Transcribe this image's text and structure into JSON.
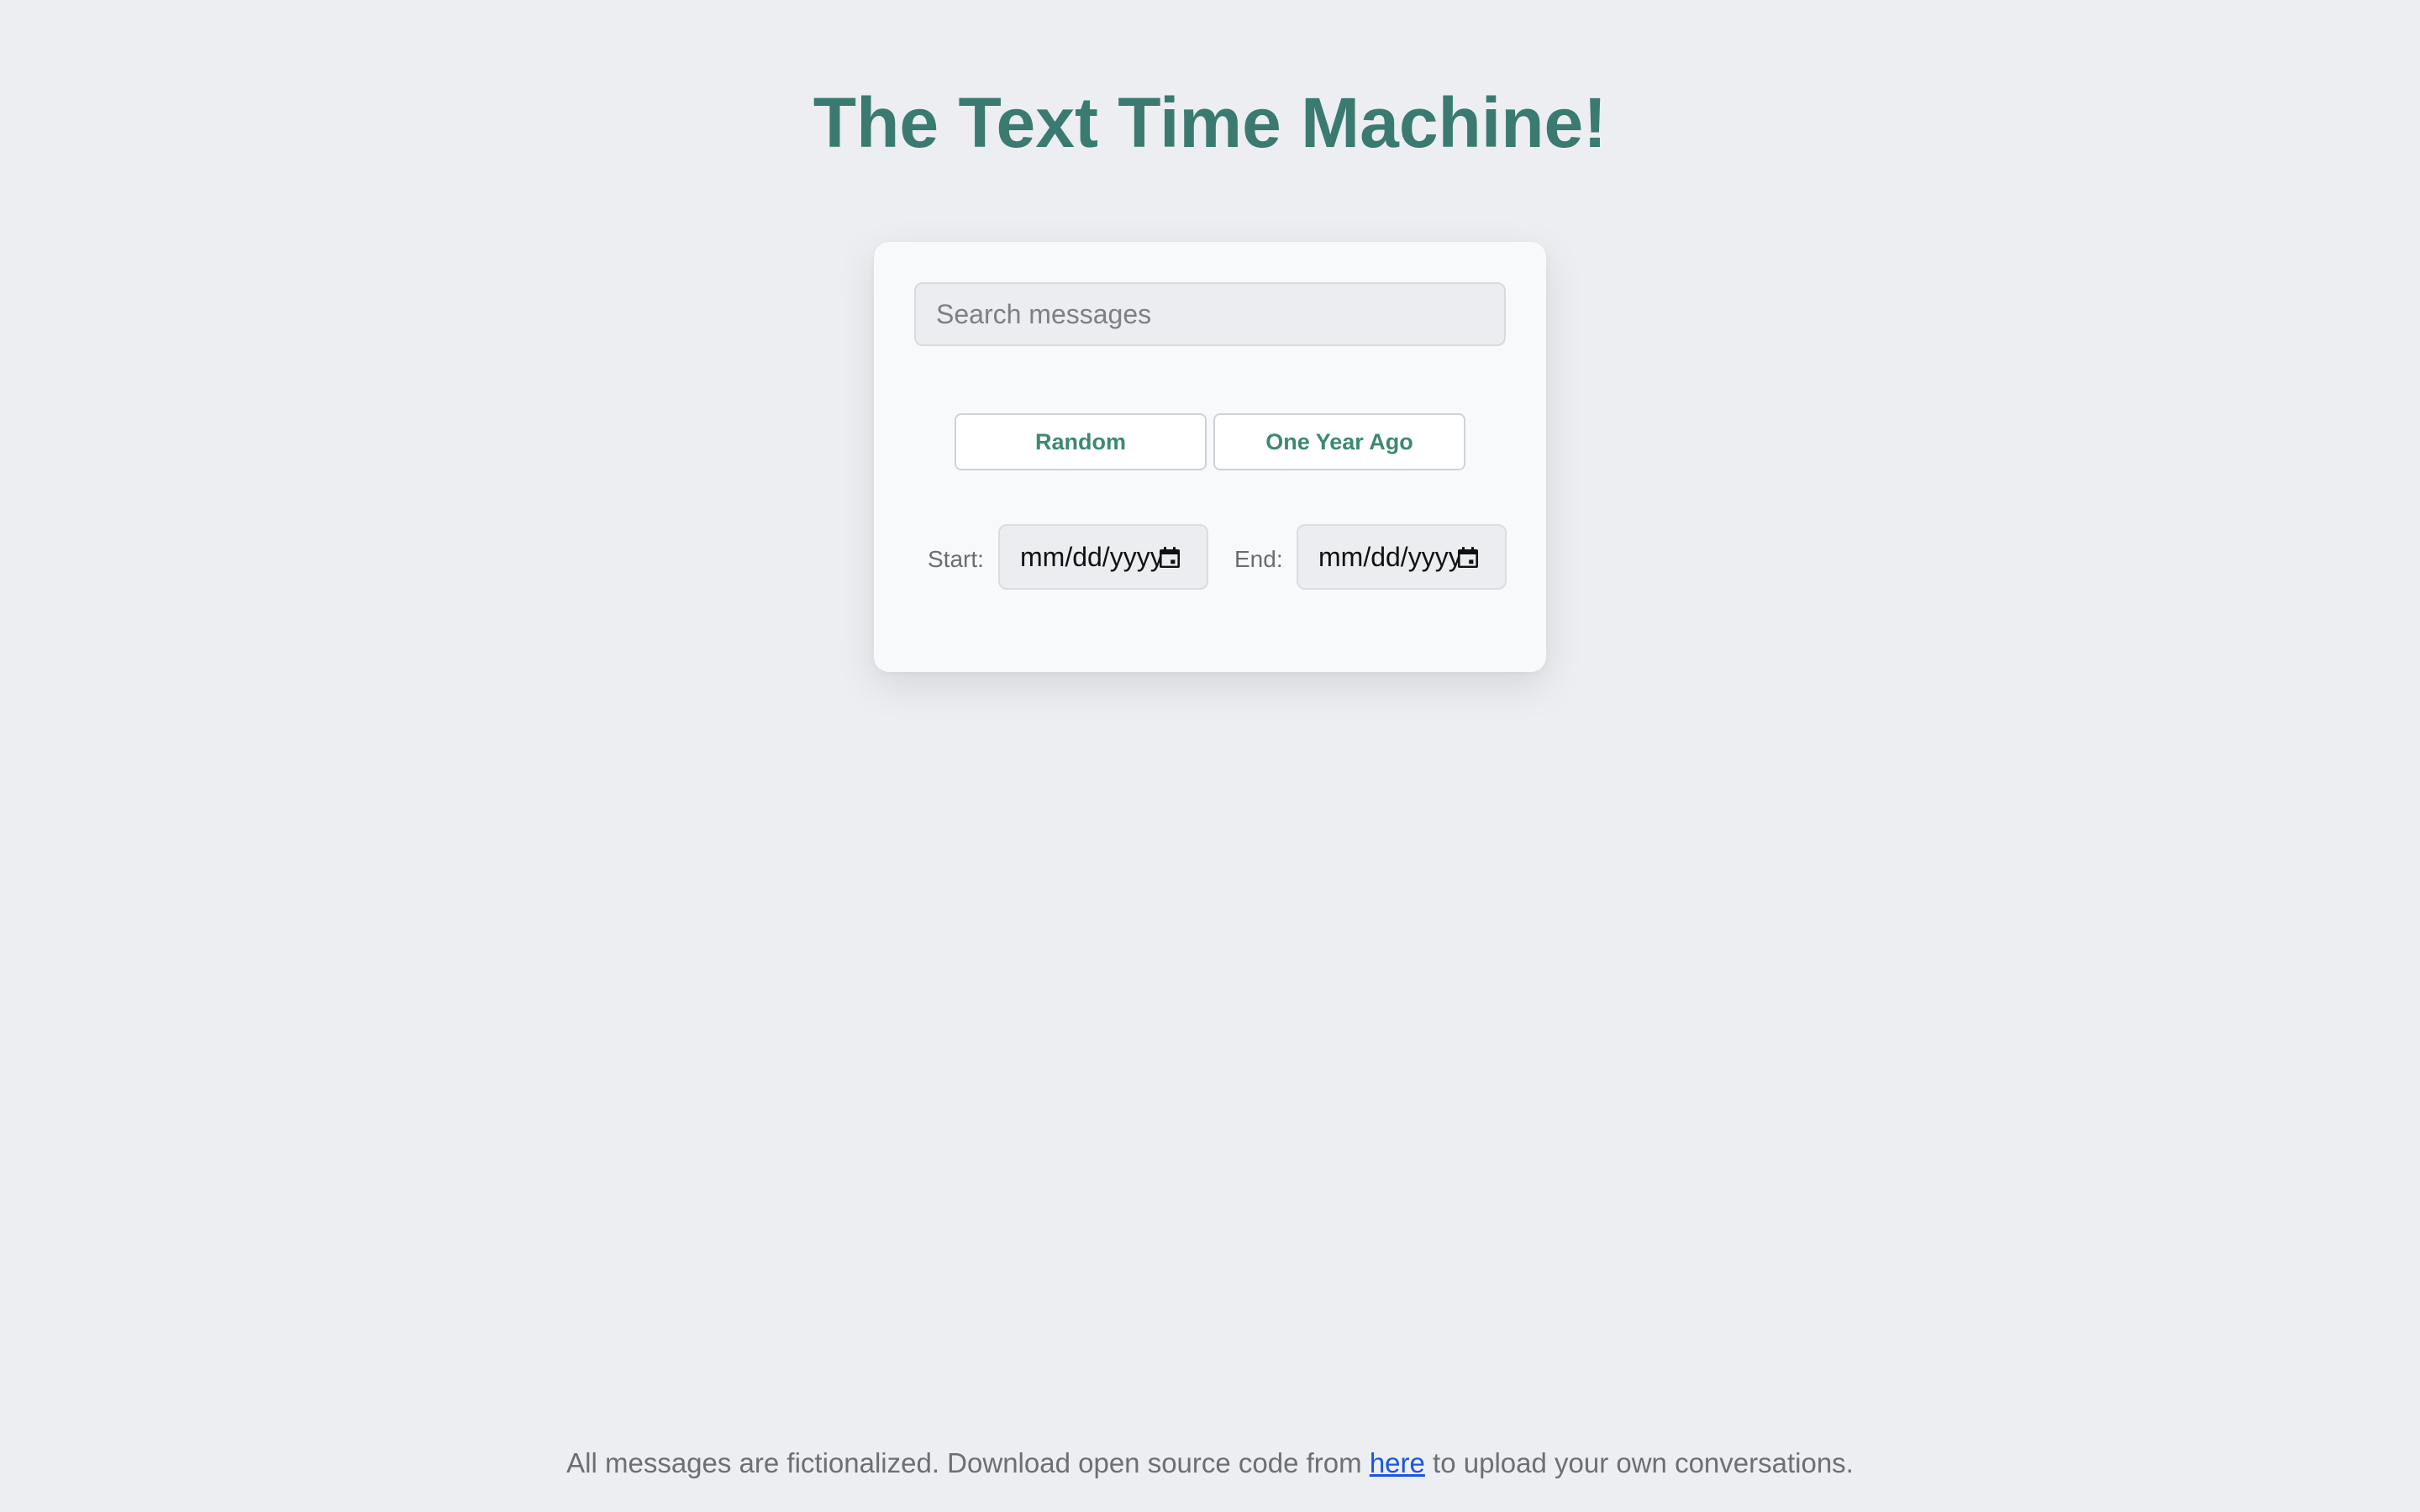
{
  "header": {
    "title": "The Text Time Machine!"
  },
  "search": {
    "placeholder": "Search messages",
    "value": ""
  },
  "actions": {
    "random_label": "Random",
    "one_year_ago_label": "One Year Ago"
  },
  "date_range": {
    "start_label": "Start:",
    "start_value": "mm/dd/yyyy",
    "end_label": "End:",
    "end_value": "mm/dd/yyyy"
  },
  "footer": {
    "text_before": "All messages are fictionalized. Download open source code from ",
    "link_label": "here",
    "text_after": " to upload your own conversations."
  },
  "colors": {
    "background": "#eceef1",
    "title": "#3b7a71",
    "button_text": "#3b8a6e",
    "link": "#1a56e0"
  },
  "icons": {
    "date_picker": "calendar-icon"
  }
}
